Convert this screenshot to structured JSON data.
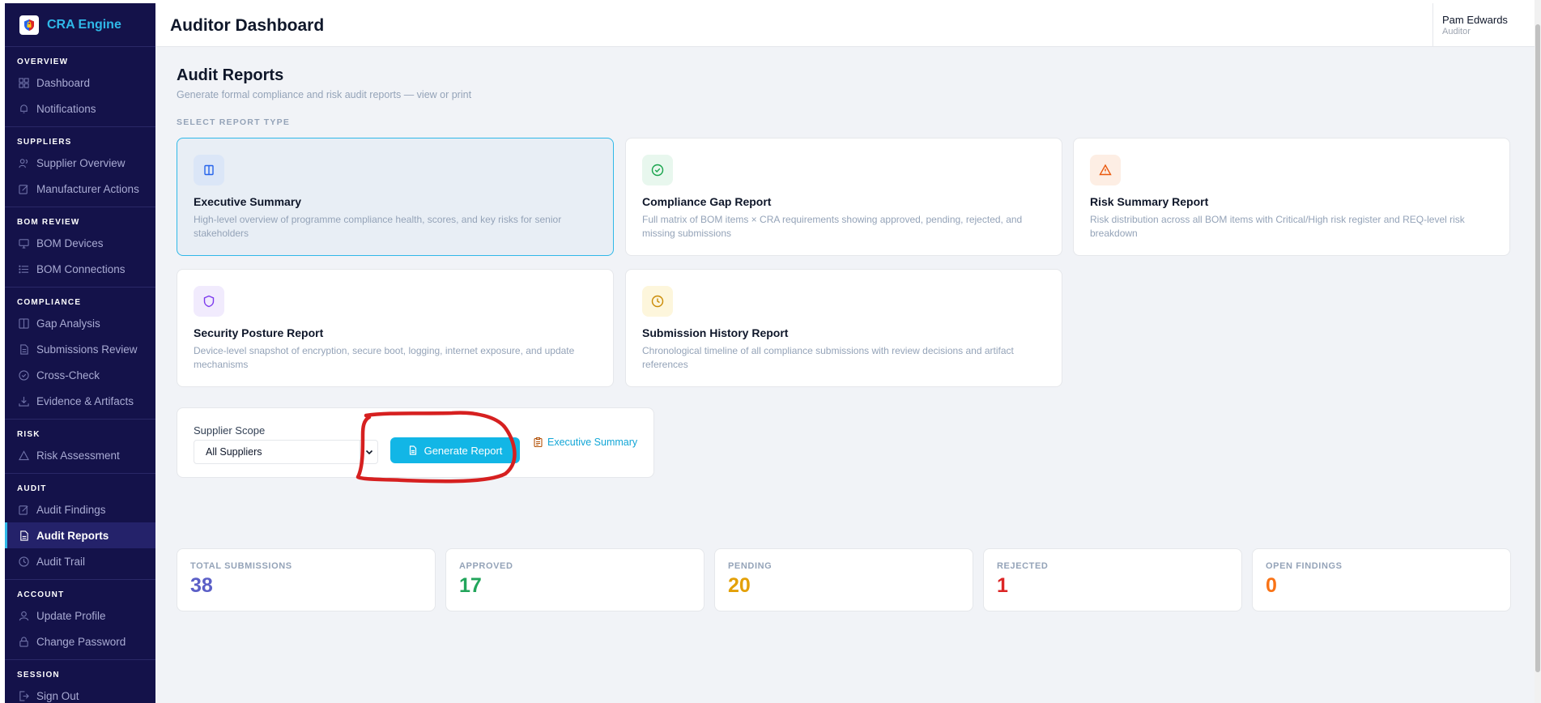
{
  "app": {
    "name": "CRA Engine"
  },
  "header": {
    "title": "Auditor Dashboard",
    "user_name": "Pam Edwards",
    "user_role": "Auditor"
  },
  "sidebar": {
    "sections": [
      {
        "label": "OVERVIEW",
        "items": [
          {
            "label": "Dashboard",
            "icon": "grid-icon"
          },
          {
            "label": "Notifications",
            "icon": "bell-icon"
          }
        ]
      },
      {
        "label": "SUPPLIERS",
        "items": [
          {
            "label": "Supplier Overview",
            "icon": "users-icon"
          },
          {
            "label": "Manufacturer Actions",
            "icon": "edit-icon"
          }
        ]
      },
      {
        "label": "BOM REVIEW",
        "items": [
          {
            "label": "BOM Devices",
            "icon": "monitor-icon"
          },
          {
            "label": "BOM Connections",
            "icon": "list-icon"
          }
        ]
      },
      {
        "label": "COMPLIANCE",
        "items": [
          {
            "label": "Gap Analysis",
            "icon": "columns-icon"
          },
          {
            "label": "Submissions Review",
            "icon": "file-icon"
          },
          {
            "label": "Cross-Check",
            "icon": "check-circle-icon"
          },
          {
            "label": "Evidence & Artifacts",
            "icon": "download-icon"
          }
        ]
      },
      {
        "label": "RISK",
        "items": [
          {
            "label": "Risk Assessment",
            "icon": "warning-icon"
          }
        ]
      },
      {
        "label": "AUDIT",
        "items": [
          {
            "label": "Audit Findings",
            "icon": "pencil-icon"
          },
          {
            "label": "Audit Reports",
            "icon": "report-icon",
            "active": true
          },
          {
            "label": "Audit Trail",
            "icon": "clock-icon"
          }
        ]
      },
      {
        "label": "ACCOUNT",
        "items": [
          {
            "label": "Update Profile",
            "icon": "user-icon"
          },
          {
            "label": "Change Password",
            "icon": "lock-icon"
          }
        ]
      },
      {
        "label": "SESSION",
        "items": [
          {
            "label": "Sign Out",
            "icon": "logout-icon"
          }
        ]
      }
    ]
  },
  "page": {
    "title": "Audit Reports",
    "subtitle": "Generate formal compliance and risk audit reports — view or print",
    "select_label": "SELECT REPORT TYPE"
  },
  "report_types": [
    {
      "title": "Executive Summary",
      "description": "High-level overview of programme compliance health, scores, and key risks for senior stakeholders",
      "icon": "book-icon",
      "icon_color": "#2563eb",
      "icon_bg": "#dbe6f7",
      "selected": true
    },
    {
      "title": "Compliance Gap Report",
      "description": "Full matrix of BOM items × CRA requirements showing approved, pending, rejected, and missing submissions",
      "icon": "check-circle-icon",
      "icon_color": "#16a34a",
      "icon_bg": "#e8f7ee"
    },
    {
      "title": "Risk Summary Report",
      "description": "Risk distribution across all BOM items with Critical/High risk register and REQ-level risk breakdown",
      "icon": "warning-icon",
      "icon_color": "#ea580c",
      "icon_bg": "#fdeee4"
    },
    {
      "title": "Security Posture Report",
      "description": "Device-level snapshot of encryption, secure boot, logging, internet exposure, and update mechanisms",
      "icon": "shield-icon",
      "icon_color": "#7c3aed",
      "icon_bg": "#f1ebfd"
    },
    {
      "title": "Submission History Report",
      "description": "Chronological timeline of all compliance submissions with review decisions and artifact references",
      "icon": "clock-icon",
      "icon_color": "#ca8a04",
      "icon_bg": "#fdf6dc"
    }
  ],
  "generator": {
    "scope_label": "Supplier Scope",
    "scope_value": "All Suppliers",
    "button_label": "Generate Report",
    "selected_report": "Executive Summary"
  },
  "stats": [
    {
      "label": "TOTAL SUBMISSIONS",
      "value": "38",
      "color": "#5b5fc7"
    },
    {
      "label": "APPROVED",
      "value": "17",
      "color": "#22a55b"
    },
    {
      "label": "PENDING",
      "value": "20",
      "color": "#e3a008"
    },
    {
      "label": "REJECTED",
      "value": "1",
      "color": "#dc2626"
    },
    {
      "label": "OPEN FINDINGS",
      "value": "0",
      "color": "#f97316"
    }
  ],
  "colors": {
    "accent": "#12b6e6",
    "sidebar_bg": "#14124a",
    "annotation": "#d62020"
  }
}
